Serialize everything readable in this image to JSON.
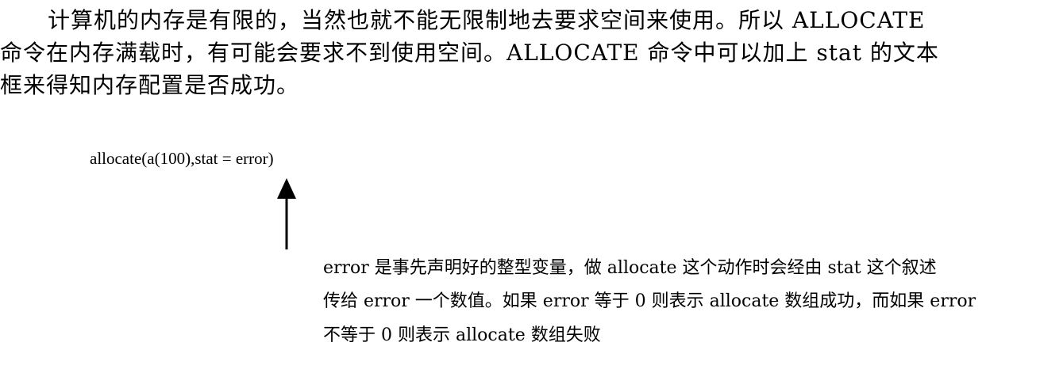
{
  "paragraph": {
    "lines": [
      "计算机的内存是有限的，当然也就不能无限制地去要求空间来使用。所以 ALLOCATE",
      "命令在内存满载时，有可能会要求不到使用空间。ALLOCATE 命令中可以加上 stat 的文本",
      "框来得知内存配置是否成功。"
    ]
  },
  "figure": {
    "code": "allocate(a(100),stat = error)",
    "arrow_icon": "up-arrow-icon",
    "note_lines": [
      "error 是事先声明好的整型变量，做 allocate 这个动作时会经由 stat 这个叙述",
      "传给 error 一个数值。如果 error 等于 0 则表示 allocate 数组成功，而如果 error",
      "不等于 0 则表示 allocate 数组失败"
    ]
  }
}
